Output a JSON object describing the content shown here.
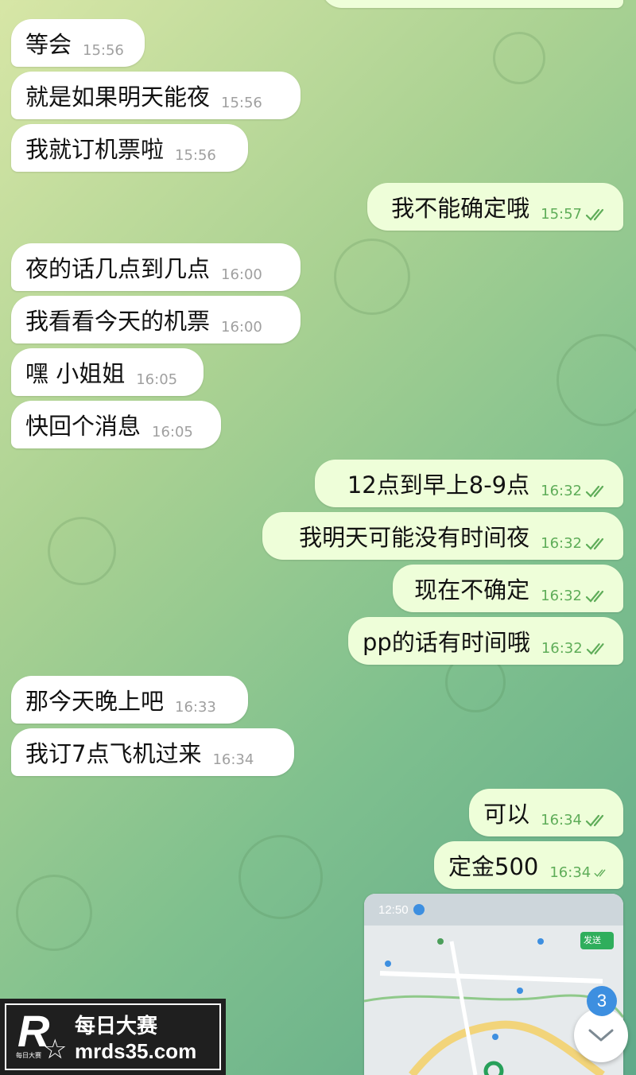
{
  "messages": [
    {
      "text": "等会",
      "time": "15:56",
      "dir": "in"
    },
    {
      "text": "就是如果明天能夜",
      "time": "15:56",
      "dir": "in"
    },
    {
      "text": "我就订机票啦",
      "time": "15:56",
      "dir": "in"
    },
    {
      "text": "我不能确定哦",
      "time": "15:57",
      "dir": "out"
    },
    {
      "text": "夜的话几点到几点",
      "time": "16:00",
      "dir": "in"
    },
    {
      "text": "我看看今天的机票",
      "time": "16:00",
      "dir": "in"
    },
    {
      "text": "嘿 小姐姐",
      "time": "16:05",
      "dir": "in"
    },
    {
      "text": "快回个消息",
      "time": "16:05",
      "dir": "in"
    },
    {
      "text": "12点到早上8-9点",
      "time": "16:32",
      "dir": "out"
    },
    {
      "text": "我明天可能没有时间夜",
      "time": "16:32",
      "dir": "out"
    },
    {
      "text": "现在不确定",
      "time": "16:32",
      "dir": "out"
    },
    {
      "text": "pp的话有时间哦",
      "time": "16:32",
      "dir": "out"
    },
    {
      "text": "那今天晚上吧",
      "time": "16:33",
      "dir": "in"
    },
    {
      "text": "我订7点飞机过来",
      "time": "16:34",
      "dir": "in"
    },
    {
      "text": "可以",
      "time": "16:34",
      "dir": "out"
    },
    {
      "text": "定金500",
      "time": "16:34",
      "dir": "out"
    }
  ],
  "map_preview": {
    "status_time": "12:50",
    "button_label": "发送"
  },
  "unread_badge": "3",
  "watermark": {
    "logo_letter": "R",
    "logo_sub": "每日大赛",
    "title": "每日大赛",
    "url": "mrds35.com"
  },
  "colors": {
    "incoming_bubble": "#ffffff",
    "outgoing_bubble": "#eefed9",
    "check_color": "#5fad59",
    "badge": "#3d8fe0"
  }
}
